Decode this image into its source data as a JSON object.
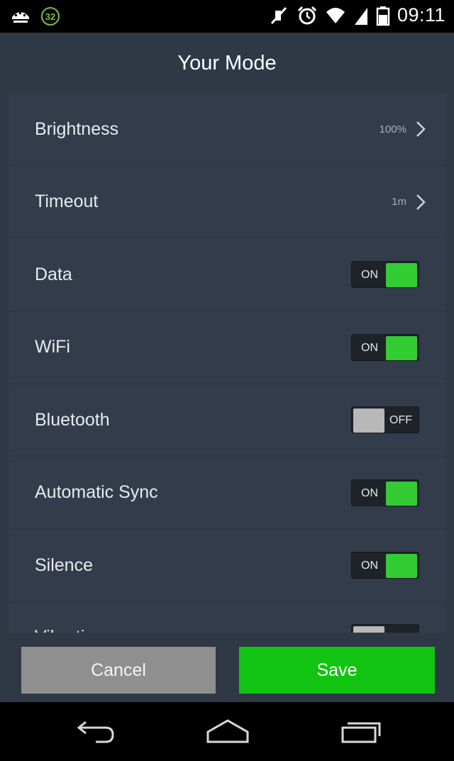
{
  "status_bar": {
    "battery_notification": "32",
    "time": "09:11",
    "icons": [
      "usb-icon",
      "battery-notification-icon",
      "mute-icon",
      "alarm-icon",
      "wifi-icon",
      "signal-icon",
      "battery-icon"
    ]
  },
  "header": {
    "title": "Your Mode"
  },
  "settings": {
    "brightness": {
      "label": "Brightness",
      "value": "100%"
    },
    "timeout": {
      "label": "Timeout",
      "value": "1m"
    },
    "data": {
      "label": "Data",
      "state": "ON"
    },
    "wifi": {
      "label": "WiFi",
      "state": "ON"
    },
    "bluetooth": {
      "label": "Bluetooth",
      "state": "OFF"
    },
    "sync": {
      "label": "Automatic Sync",
      "state": "ON"
    },
    "silence": {
      "label": "Silence",
      "state": "ON"
    },
    "vibration": {
      "label": "Vibration",
      "state": "OFF"
    }
  },
  "buttons": {
    "cancel": "Cancel",
    "save": "Save"
  },
  "colors": {
    "toggle_on": "#33cc33",
    "save_button": "#11c411",
    "cancel_button": "#8f8f8f",
    "background": "#2f3845"
  },
  "nav_bar": {
    "icons": [
      "back-icon",
      "home-icon",
      "recent-apps-icon"
    ]
  }
}
